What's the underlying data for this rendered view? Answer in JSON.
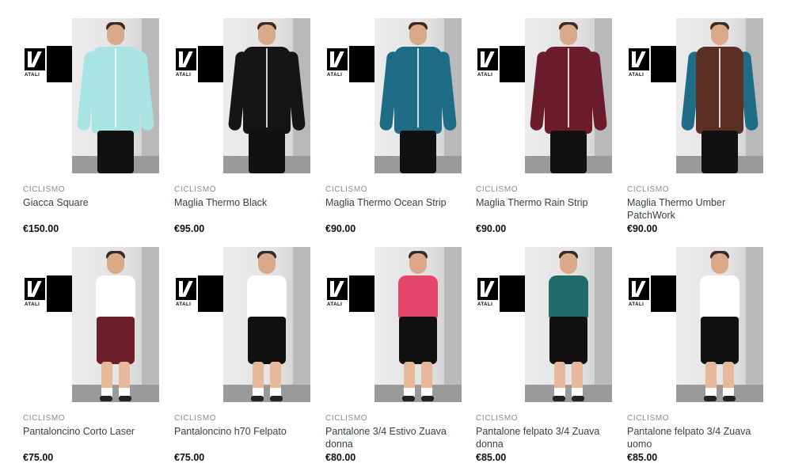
{
  "brand": {
    "wordmark": "ATALI"
  },
  "products": [
    {
      "category": "CICLISMO",
      "title": "Giacca Square",
      "price": "€150.00",
      "style": "jacket",
      "color": "#a9e4e4"
    },
    {
      "category": "CICLISMO",
      "title": "Maglia Thermo Black",
      "price": "€95.00",
      "style": "jacket",
      "color": "#151515"
    },
    {
      "category": "CICLISMO",
      "title": "Maglia Thermo Ocean Strip",
      "price": "€90.00",
      "style": "jacket",
      "color": "#1f6c86"
    },
    {
      "category": "CICLISMO",
      "title": "Maglia Thermo Rain Strip",
      "price": "€90.00",
      "style": "jacket",
      "color": "#6c1b2c"
    },
    {
      "category": "CICLISMO",
      "title": "Maglia Thermo Umber PatchWork",
      "price": "€90.00",
      "style": "jacket",
      "color": "#5b2f23",
      "sleeve": "#1f6c86"
    },
    {
      "category": "CICLISMO",
      "title": "Pantaloncino Corto Laser",
      "price": "€75.00",
      "style": "bib",
      "color": "#6a1f2a",
      "top": "#ffffff"
    },
    {
      "category": "CICLISMO",
      "title": "Pantaloncino h70 Felpato",
      "price": "€75.00",
      "style": "bib",
      "color": "#111111",
      "top": "#ffffff"
    },
    {
      "category": "CICLISMO",
      "title": "Pantalone 3/4 Estivo Zuava donna",
      "price": "€80.00",
      "style": "bib",
      "color": "#111111",
      "top": "#e6466a"
    },
    {
      "category": "CICLISMO",
      "title": "Pantalone felpato 3/4 Zuava donna",
      "price": "€85.00",
      "style": "bib",
      "color": "#111111",
      "top": "#1f6c6a"
    },
    {
      "category": "CICLISMO",
      "title": "Pantalone felpato 3/4 Zuava uomo",
      "price": "€85.00",
      "style": "bib",
      "color": "#111111",
      "top": "#ffffff"
    }
  ]
}
